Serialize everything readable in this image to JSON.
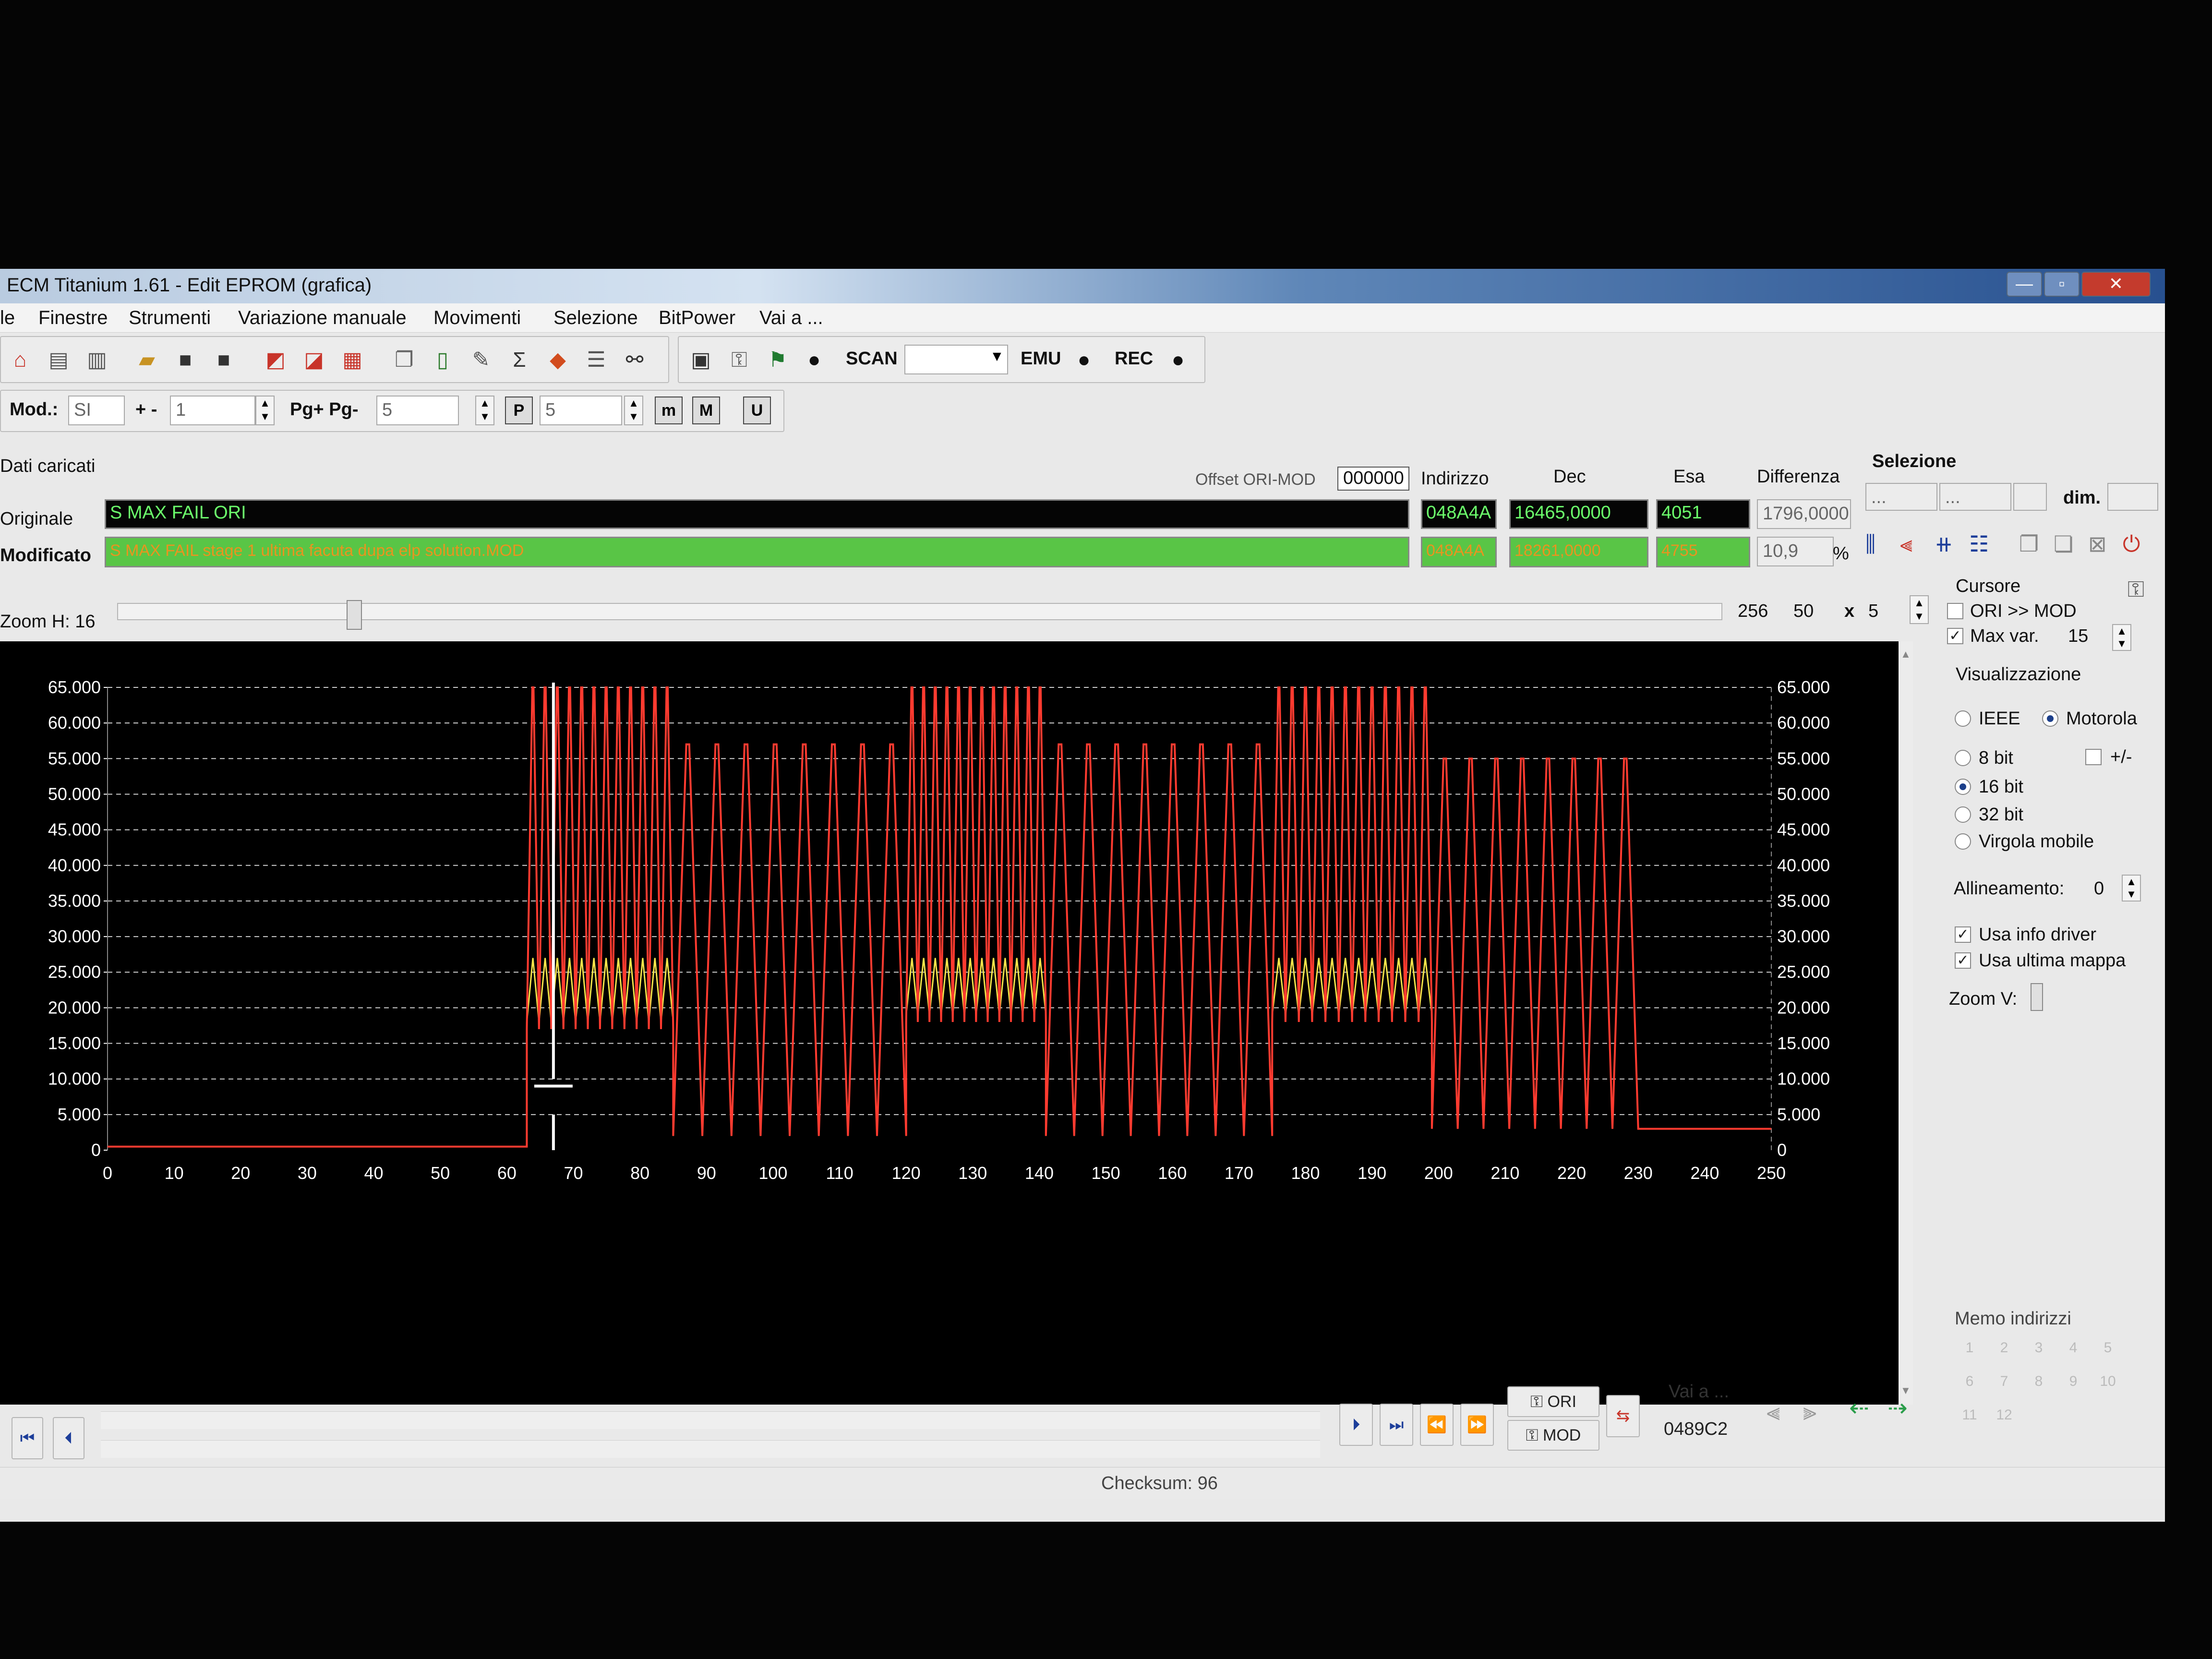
{
  "window": {
    "title": "ECM Titanium 1.61 - Edit EPROM (grafica)",
    "btn_minimize": "—",
    "btn_maximize": "▫",
    "btn_close": "✕"
  },
  "menu": [
    "le",
    "Finestre",
    "Strumenti",
    "Variazione manuale",
    "Movimenti",
    "Selezione",
    "BitPower",
    "Vai a ..."
  ],
  "toolbar": {
    "scan_label": "SCAN",
    "emu_label": "EMU",
    "rec_label": "REC",
    "scan_select_value": ""
  },
  "toolbar2": {
    "mod_label": "Mod.:",
    "mod_value": "SI",
    "plusminus_label": "+ -",
    "plusminus_value": "1",
    "pg_label": "Pg+ Pg-",
    "pg_value": "5",
    "p_value": "5",
    "btn_p": "P",
    "btn_m1": "m",
    "btn_m2": "M",
    "btn_u": "U"
  },
  "data_loaded": {
    "label": "Dati caricati",
    "offset_label": "Offset ORI-MOD",
    "offset_value": "000000",
    "indirizzo_label": "Indirizzo",
    "dec_label": "Dec",
    "esa_label": "Esa",
    "differenza_label": "Differenza",
    "originale_label": "Originale",
    "originale_value": "S MAX FAIL ORI",
    "modificato_label": "Modificato",
    "modificato_value": "S MAX FAIL stage 1 ultima facuta dupa elp solution.MOD",
    "ori_indirizzo": "048A4A",
    "ori_dec": "16465,0000",
    "ori_esa": "4051",
    "ori_diff": "1796,0000",
    "mod_indirizzo": "048A4A",
    "mod_dec": "18261,0000",
    "mod_esa": "4755",
    "mod_diff": "10,9",
    "pct": "%"
  },
  "selezione": {
    "label": "Selezione",
    "field1": "...",
    "field2": "...",
    "dim_label": "dim."
  },
  "zoom": {
    "label": "Zoom H: 16",
    "val1": "256",
    "val2": "50",
    "x_label": "x",
    "val3": "5"
  },
  "cursore": {
    "label": "Cursore",
    "ori_mod_label": "ORI >> MOD",
    "ori_mod_checked": false,
    "max_var_label": "Max var.",
    "max_var_checked": true,
    "max_var_value": "15"
  },
  "visualizzazione": {
    "label": "Visualizzazione",
    "ieee": "IEEE",
    "motorola": "Motorola",
    "byte_order_selected": "Motorola",
    "bit8": "8 bit",
    "plusminus": "+/-",
    "bit16": "16 bit",
    "bit32": "32 bit",
    "virgola": "Virgola mobile",
    "format_selected": "16 bit",
    "allineamento_label": "Allineamento:",
    "allineamento_value": "0",
    "usa_info_driver": "Usa info driver",
    "usa_ultima_mappa": "Usa ultima mappa",
    "zoom_v_label": "Zoom V:",
    "memo_label": "Memo indirizzi"
  },
  "memo_buttons": [
    "1",
    "2",
    "3",
    "4",
    "5",
    "6",
    "7",
    "8",
    "9",
    "10",
    "11",
    "12"
  ],
  "bottom": {
    "ori_label": "ORI",
    "mod_label": "MOD",
    "vai_a_label": "Vai a ...",
    "vai_a_value": "0489C2",
    "checksum": "Checksum: 96"
  },
  "chart_data": {
    "type": "line",
    "x_ticks": [
      "0",
      "10",
      "20",
      "30",
      "40",
      "50",
      "60",
      "70",
      "80",
      "90",
      "100",
      "110",
      "120",
      "130",
      "140",
      "150",
      "160",
      "170",
      "180",
      "190",
      "200",
      "210",
      "220",
      "230",
      "240",
      "250"
    ],
    "y_ticks_left": [
      "0",
      "5.000",
      "10.000",
      "15.000",
      "20.000",
      "25.000",
      "30.000",
      "35.000",
      "40.000",
      "45.000",
      "50.000",
      "55.000",
      "60.000",
      "65.000"
    ],
    "y_ticks_right": [
      "0",
      "5.000",
      "10.000",
      "15.000",
      "20.000",
      "25.000",
      "30.000",
      "35.000",
      "40.000",
      "45.000",
      "50.000",
      "55.000",
      "60.000",
      "65.000"
    ],
    "xlim": [
      0,
      250
    ],
    "ylim": [
      0,
      65000
    ],
    "grid": true,
    "cursor_x": 67,
    "segments": [
      {
        "x_start": 0,
        "x_end": 63,
        "pattern": "flat",
        "low": 500,
        "high": 500
      },
      {
        "x_start": 63,
        "x_end": 85,
        "pattern": "spikes",
        "count": 12,
        "low": 17000,
        "high": 65000,
        "ori_low": 18000,
        "ori_high": 27000
      },
      {
        "x_start": 85,
        "x_end": 120,
        "pattern": "spikes",
        "count": 8,
        "low": 2000,
        "high": 57000
      },
      {
        "x_start": 120,
        "x_end": 141,
        "pattern": "spikes",
        "count": 12,
        "low": 18000,
        "high": 65000,
        "ori_low": 19000,
        "ori_high": 27000
      },
      {
        "x_start": 141,
        "x_end": 175,
        "pattern": "spikes",
        "count": 8,
        "low": 2000,
        "high": 57000
      },
      {
        "x_start": 175,
        "x_end": 199,
        "pattern": "spikes",
        "count": 12,
        "low": 18000,
        "high": 65000,
        "ori_low": 19000,
        "ori_high": 27000
      },
      {
        "x_start": 199,
        "x_end": 230,
        "pattern": "spikes",
        "count": 8,
        "low": 3000,
        "high": 55000
      },
      {
        "x_start": 230,
        "x_end": 250,
        "pattern": "flat",
        "low": 3000,
        "high": 3000
      }
    ],
    "colors": {
      "mod": "#ff3b30",
      "ori": "#f5e44a",
      "grid": "#cfcfcf",
      "background": "#000000",
      "cursor": "#ffffff"
    }
  }
}
